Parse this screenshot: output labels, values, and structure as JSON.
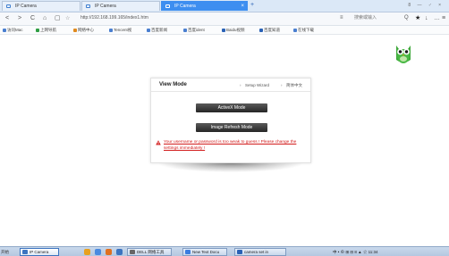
{
  "tabs": [
    {
      "label": "IP Camera"
    },
    {
      "label": "IP Camera"
    },
    {
      "label": "IP Camera"
    }
  ],
  "new_tab_symbol": "+",
  "window_controls": "8 — ♂ ×",
  "nav": {
    "back": "<",
    "forward": ">",
    "refresh": "C",
    "home": "⌂",
    "url": "http://192.168.199.165/index1.htm",
    "search_placeholder": "搜索或输入",
    "search_icon": "Q",
    "star": "★",
    "download": "↓",
    "more": "…",
    "menu": "≡"
  },
  "bookmarks": [
    {
      "label": "访问Mac",
      "color": "#4a7fd0"
    },
    {
      "label": "上网导航",
      "color": "#2f9e44"
    },
    {
      "label": "网络中心",
      "color": "#e08a1e"
    },
    {
      "label": "Tencent视",
      "color": "#4a7fd0"
    },
    {
      "label": "百度新闻",
      "color": "#4a7fd0"
    },
    {
      "label": "百度ident",
      "color": "#4a7fd0"
    },
    {
      "label": "Baidu视频",
      "color": "#2a62b6"
    },
    {
      "label": "百度知道",
      "color": "#2a62b6"
    },
    {
      "label": "在线下载",
      "color": "#4a7fd0"
    }
  ],
  "panel": {
    "title": "View Mode",
    "setup_link": "Setup Wizard",
    "lang_link": "简体中文",
    "buttons": [
      {
        "label": "ActiveX Mode"
      },
      {
        "label": "Image Refresh Mode"
      }
    ],
    "warning_text": "Your username or password is too weak to guess ! Please change the settings immediately !"
  },
  "taskbar": {
    "start_label": "开始",
    "items": [
      {
        "label": "IP Camera",
        "color": "#3d74c0"
      },
      {
        "label": "DELL 网络工具",
        "color": "#666666"
      },
      {
        "label": "New Text Docu",
        "color": "#3b7de0"
      },
      {
        "label": "camera set in",
        "color": "#2a62b6"
      }
    ],
    "quick_launch_colors": [
      "#e8a020",
      "#4a8ae0",
      "#e07020",
      "#3d74c0"
    ],
    "tray_text": "中 • ⊕ ⊞ ⊟ 8 ▲ ☆ 11:34"
  },
  "colors": {
    "accent": "#3d8ef0",
    "warning": "#d21a1a",
    "button_dark": "#2b2b2b"
  }
}
